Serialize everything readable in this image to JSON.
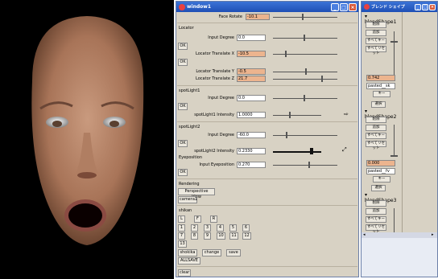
{
  "window1": {
    "title": "window1",
    "face_rotate": {
      "label": "Face Rotate",
      "value": "-10.1"
    },
    "locator": {
      "section": "Locator",
      "input_degree_label": "Input Degree",
      "input_degree_value": "0.0",
      "ok1": "OK",
      "translate_x_label": "Locator Translate X",
      "translate_x_value": "-10.5",
      "ok2": "OK",
      "translate_y_label": "Locator Translate Y",
      "translate_y_value": "-0.5",
      "translate_z_label": "Locator Translate Z",
      "translate_z_value": "21.7"
    },
    "spotlight1": {
      "section": "spotLight1",
      "input_degree_label": "Input Degree",
      "input_degree_value": "0.0",
      "ok": "OK",
      "intensity_label": "spotLight1 Intensity",
      "intensity_value": "1.0000"
    },
    "spotlight2": {
      "section": "spotLight2",
      "input_degree_label": "Input Degree",
      "input_degree_value": "-60.0",
      "ok": "OK",
      "intensity_label": "spotLight2 Intensity",
      "intensity_value": "0.2330"
    },
    "eyeposition": {
      "section": "Eyeposition",
      "input_label": "Input Eyeposition",
      "input_value": "0.270",
      "ok": "OK"
    },
    "rendering": {
      "section": "Rendering",
      "perspective_button": "Perspective View",
      "camera_button": "camera1"
    },
    "shikan": {
      "section": "shikan",
      "row1": [
        "L",
        "F",
        "R"
      ],
      "row2": [
        "1",
        "2",
        "3",
        "4",
        "5",
        "6"
      ],
      "row3": [
        "7",
        "8",
        "9",
        "10",
        "11",
        "12"
      ],
      "row4": [
        "13"
      ],
      "shokika": "shokika",
      "change": "change",
      "save": "save",
      "allsave": "ALLSAVE"
    },
    "clear": "clear"
  },
  "blend_window": {
    "title": "ブレンド シェイプ",
    "shapes": [
      {
        "name": "blendShape1",
        "delete": "削除",
        "add": "追加",
        "key_all": "すべてキー",
        "reset_all": "すべてリセット",
        "value": "0.742",
        "target": "pasted__sk",
        "key": "キー",
        "select": "選択"
      },
      {
        "name": "blendShape2",
        "delete": "削除",
        "add": "追加",
        "key_all": "すべてキー",
        "reset_all": "すべてリセット",
        "value": "0.000",
        "target": "pasted__fv",
        "key": "キー",
        "select": "選択"
      },
      {
        "name": "blendShape3",
        "delete": "削除",
        "add": "追加",
        "key_all": "すべてキー",
        "reset_all": "すべてリセット"
      }
    ]
  },
  "colors": {
    "title_blue": "#2a5fcc",
    "panel_bg": "#d8d2c4",
    "field_orange": "#ecb48e",
    "viewport_bg": "#000000"
  }
}
